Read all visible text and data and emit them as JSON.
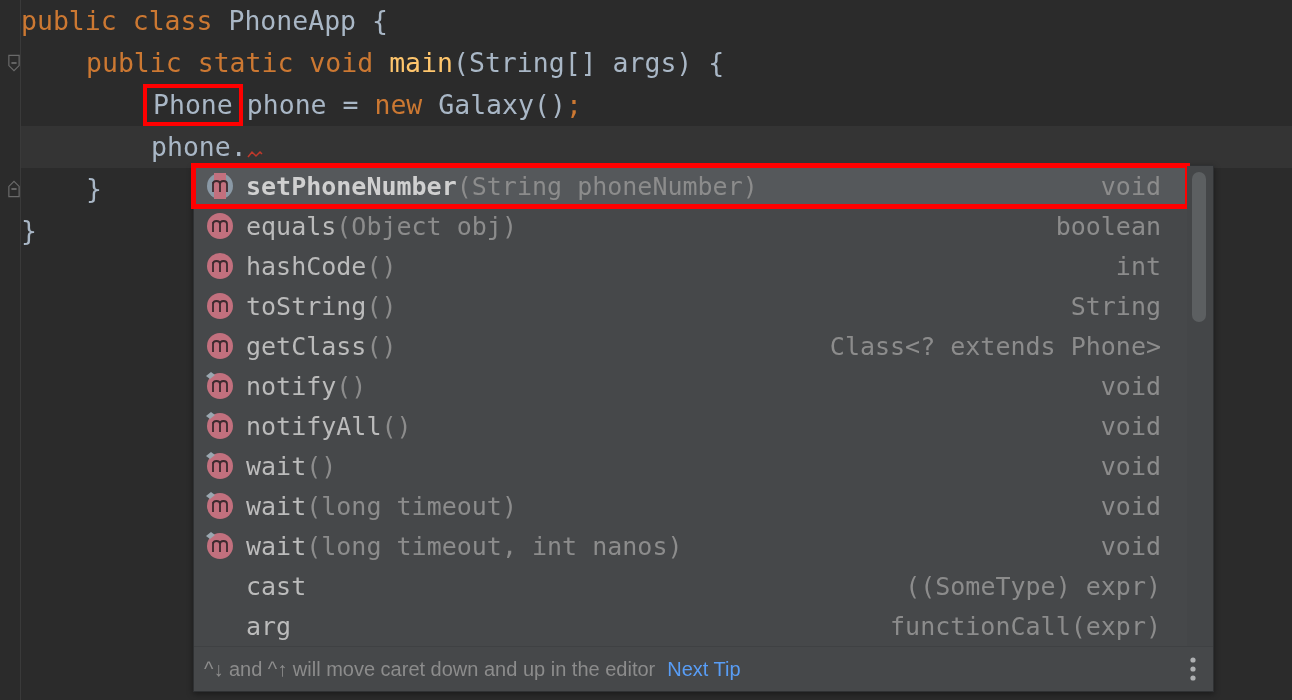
{
  "editor": {
    "lines": [
      {
        "tokens": [
          {
            "text": "public class ",
            "kind": "keyword"
          },
          {
            "text": "PhoneApp {",
            "kind": "plain"
          }
        ],
        "children": [
          {
            "kind": "fold-start",
            "tokens": [
              {
                "text": "public static void ",
                "kind": "keyword"
              },
              {
                "text": "main",
                "kind": "method"
              },
              {
                "text": "(String[] args) {",
                "kind": "plain"
              }
            ],
            "children": [
              {
                "tokens": [
                  {
                    "text": "Phone",
                    "kind": "plain",
                    "highlighted": true
                  },
                  {
                    "text": "phone = ",
                    "kind": "plain",
                    "highlighted": false
                  },
                  {
                    "text": "new ",
                    "kind": "keyword"
                  },
                  {
                    "text": "Galaxy()",
                    "kind": "plain"
                  },
                  {
                    "text": ";",
                    "kind": "keyword"
                  }
                ]
              },
              {
                "current": true,
                "tokens": [
                  {
                    "text": "phone.",
                    "kind": "plain",
                    "highlighted": false
                  },
                  {
                    "kind": "error-mark"
                  }
                ]
              }
            ]
          },
          {
            "kind": "fold-end",
            "tokens": [
              {
                "text": "}",
                "kind": "plain"
              }
            ]
          }
        ]
      },
      {
        "tokens": [
          {
            "text": "}",
            "kind": "plain"
          }
        ]
      }
    ]
  },
  "completion": {
    "items": [
      {
        "kind": "method-partial",
        "name": "setPhoneNumber",
        "params": "(String phoneNumber)",
        "type": "void",
        "selected": true,
        "highlighted": true
      },
      {
        "kind": "method",
        "name": "equals",
        "params": "(Object obj)",
        "type": "boolean",
        "selected": false,
        "highlighted": false
      },
      {
        "kind": "method",
        "name": "hashCode",
        "params": "()",
        "type": "int",
        "selected": false,
        "highlighted": false
      },
      {
        "kind": "method",
        "name": "toString",
        "params": "()",
        "type": "String",
        "selected": false,
        "highlighted": false
      },
      {
        "kind": "method",
        "name": "getClass",
        "params": "()",
        "type": "Class<? extends Phone>",
        "selected": false,
        "highlighted": false
      },
      {
        "kind": "method-pinned",
        "name": "notify",
        "params": "()",
        "type": "void",
        "selected": false,
        "highlighted": false
      },
      {
        "kind": "method-pinned",
        "name": "notifyAll",
        "params": "()",
        "type": "void",
        "selected": false,
        "highlighted": false
      },
      {
        "kind": "method-pinned",
        "name": "wait",
        "params": "()",
        "type": "void",
        "selected": false,
        "highlighted": false
      },
      {
        "kind": "method-pinned",
        "name": "wait",
        "params": "(long timeout)",
        "type": "void",
        "selected": false,
        "highlighted": false
      },
      {
        "kind": "method-pinned",
        "name": "wait",
        "params": "(long timeout, int nanos)",
        "type": "void",
        "selected": false,
        "highlighted": false
      },
      {
        "kind": "template",
        "name": "cast",
        "type": "((SomeType) expr)",
        "selected": false,
        "highlighted": false
      },
      {
        "kind": "template",
        "name": "arg",
        "type": "functionCall(expr)",
        "selected": false,
        "highlighted": false
      }
    ],
    "tip": {
      "text": "^↓ and ^↑ will move caret down and up in the editor",
      "link": "Next Tip"
    }
  }
}
